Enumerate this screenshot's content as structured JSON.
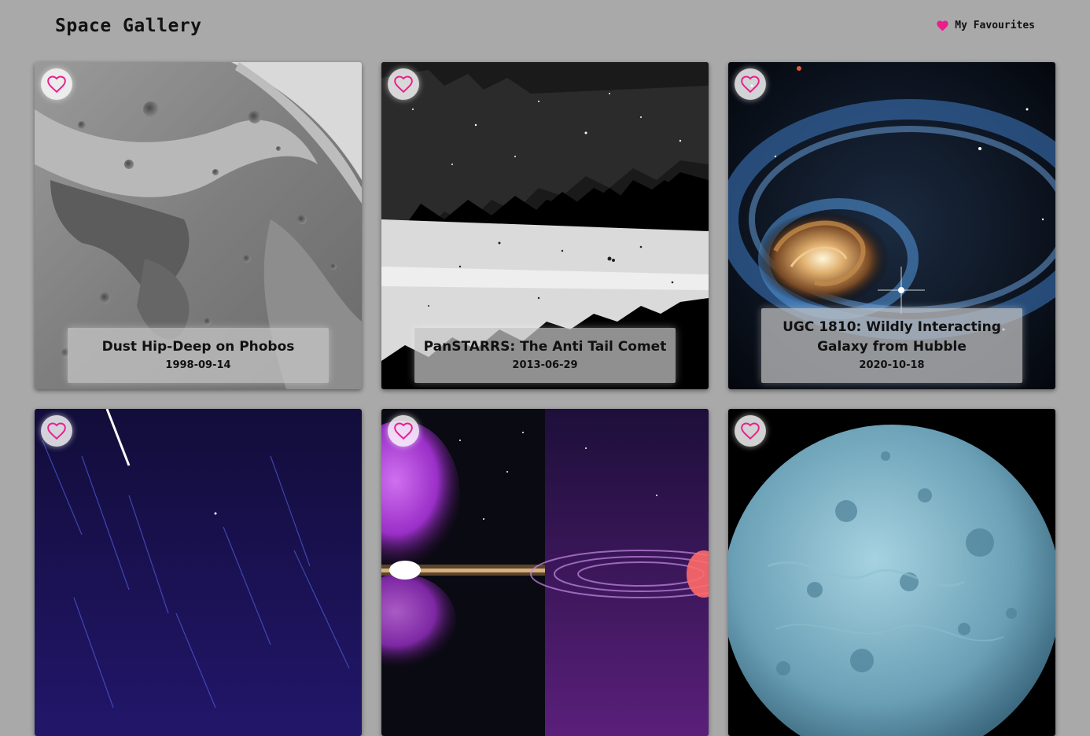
{
  "header": {
    "title": "Space Gallery",
    "favourites_label": "My Favourites",
    "accent_color": "#e91e8c"
  },
  "cards": [
    {
      "title": "Dust Hip-Deep on Phobos",
      "date": "1998-09-14",
      "favourite_icon": "heart-outline-icon"
    },
    {
      "title": "PanSTARRS: The Anti Tail Comet",
      "date": "2013-06-29",
      "favourite_icon": "heart-outline-icon"
    },
    {
      "title": "UGC 1810: Wildly Interacting Galaxy from Hubble",
      "date": "2020-10-18",
      "favourite_icon": "heart-outline-icon"
    },
    {
      "favourite_icon": "heart-outline-icon"
    },
    {
      "favourite_icon": "heart-outline-icon"
    },
    {
      "favourite_icon": "heart-outline-icon"
    }
  ]
}
